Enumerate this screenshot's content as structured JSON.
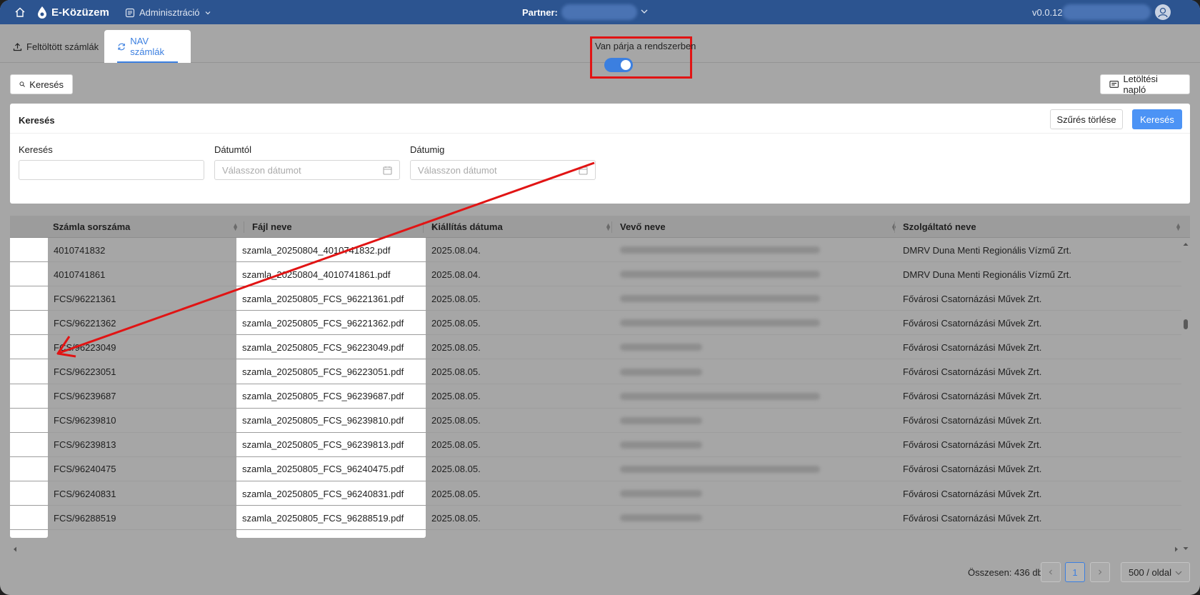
{
  "header": {
    "brand": "E-Közüzem",
    "admin_menu": "Adminisztráció",
    "partner_label": "Partner:",
    "version": "v0.0.12"
  },
  "tabs": [
    {
      "label": "Feltöltött számlák",
      "icon": "upload-icon",
      "active": false
    },
    {
      "label": "NAV számlák",
      "icon": "sync-icon",
      "active": true
    }
  ],
  "toolbar": {
    "search_label": "Keresés",
    "download_log_label": "Letöltési napló"
  },
  "filter": {
    "title": "Keresés",
    "clear_label": "Szűrés törlése",
    "search_label": "Keresés",
    "fields": {
      "search": {
        "label": "Keresés",
        "value": ""
      },
      "date_from": {
        "label": "Dátumtól",
        "placeholder": "Válasszon dátumot"
      },
      "date_to": {
        "label": "Dátumig",
        "placeholder": "Válasszon dátumot"
      },
      "has_pair": {
        "label": "Van párja a rendszerben",
        "value": true
      }
    }
  },
  "table": {
    "columns": [
      "Számla sorszáma",
      "Fájl neve",
      "Kiállítás dátuma",
      "Vevő neve",
      "Szolgáltató neve"
    ],
    "rows": [
      {
        "number": "4010741832",
        "file": "szamla_20250804_4010741832.pdf",
        "date": "2025.08.04.",
        "provider": "DMRV Duna Menti Regionális Vízmű Zrt."
      },
      {
        "number": "4010741861",
        "file": "szamla_20250804_4010741861.pdf",
        "date": "2025.08.04.",
        "provider": "DMRV Duna Menti Regionális Vízmű Zrt."
      },
      {
        "number": "FCS/96221361",
        "file": "szamla_20250805_FCS_96221361.pdf",
        "date": "2025.08.05.",
        "provider": "Fővárosi Csatornázási Művek Zrt."
      },
      {
        "number": "FCS/96221362",
        "file": "szamla_20250805_FCS_96221362.pdf",
        "date": "2025.08.05.",
        "provider": "Fővárosi Csatornázási Művek Zrt."
      },
      {
        "number": "FCS/96223049",
        "file": "szamla_20250805_FCS_96223049.pdf",
        "date": "2025.08.05.",
        "provider": "Fővárosi Csatornázási Művek Zrt."
      },
      {
        "number": "FCS/96223051",
        "file": "szamla_20250805_FCS_96223051.pdf",
        "date": "2025.08.05.",
        "provider": "Fővárosi Csatornázási Művek Zrt."
      },
      {
        "number": "FCS/96239687",
        "file": "szamla_20250805_FCS_96239687.pdf",
        "date": "2025.08.05.",
        "provider": "Fővárosi Csatornázási Művek Zrt."
      },
      {
        "number": "FCS/96239810",
        "file": "szamla_20250805_FCS_96239810.pdf",
        "date": "2025.08.05.",
        "provider": "Fővárosi Csatornázási Művek Zrt."
      },
      {
        "number": "FCS/96239813",
        "file": "szamla_20250805_FCS_96239813.pdf",
        "date": "2025.08.05.",
        "provider": "Fővárosi Csatornázási Művek Zrt."
      },
      {
        "number": "FCS/96240475",
        "file": "szamla_20250805_FCS_96240475.pdf",
        "date": "2025.08.05.",
        "provider": "Fővárosi Csatornázási Művek Zrt."
      },
      {
        "number": "FCS/96240831",
        "file": "szamla_20250805_FCS_96240831.pdf",
        "date": "2025.08.05.",
        "provider": "Fővárosi Csatornázási Művek Zrt."
      },
      {
        "number": "FCS/96288519",
        "file": "szamla_20250805_FCS_96288519.pdf",
        "date": "2025.08.05.",
        "provider": "Fővárosi Csatornázási Művek Zrt."
      }
    ]
  },
  "pagination": {
    "total_label": "Összesen: 436 db",
    "current_page": "1",
    "page_size": "500 / oldal"
  },
  "colors": {
    "topbar": "#2c5490",
    "accent": "#3b7fe0",
    "annotation": "#e11414"
  }
}
